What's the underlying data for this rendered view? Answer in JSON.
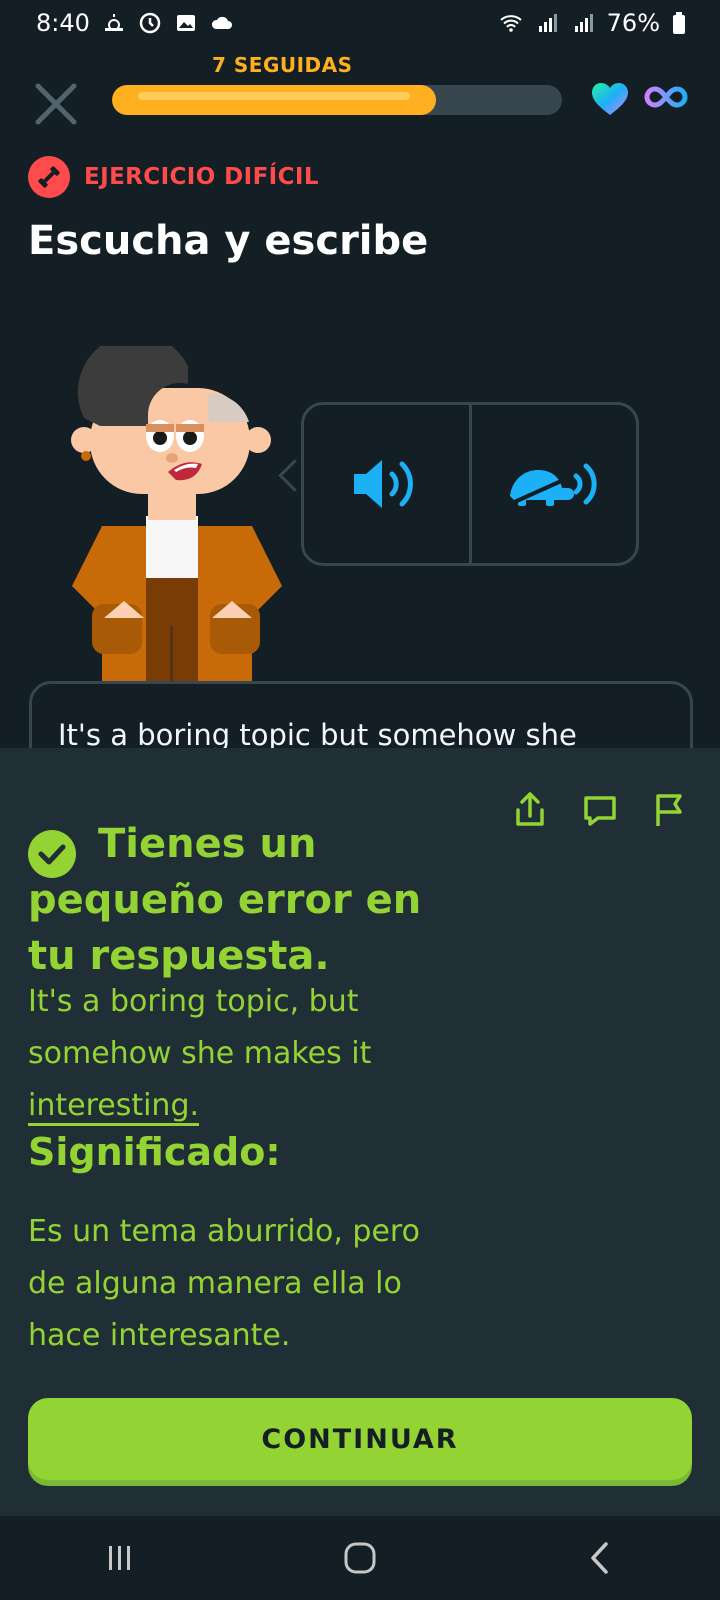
{
  "status": {
    "time": "8:40",
    "battery": "76%"
  },
  "header": {
    "streak_label": "7 SEGUIDAS",
    "progress": 0.72
  },
  "exercise": {
    "difficulty": "EJERCICIO DIFÍCIL",
    "title": "Escucha y escribe"
  },
  "answer": {
    "typed": "It's a boring topic but somehow she"
  },
  "feedback": {
    "title": "Tienes un pequeño error en tu respuesta.",
    "correct_prefix": "It's a boring topic, but somehow she makes it ",
    "correct_error_word": "interesting.",
    "meaning_label": "Significado:",
    "meaning": "Es un tema aburrido, pero de alguna manera ella lo hace interesante."
  },
  "continue_label": "CONTINUAR",
  "colors": {
    "accent_green": "#93d333",
    "streak_orange": "#ffb020",
    "error_red": "#ff4b4b",
    "audio_blue": "#1cb0f6"
  }
}
